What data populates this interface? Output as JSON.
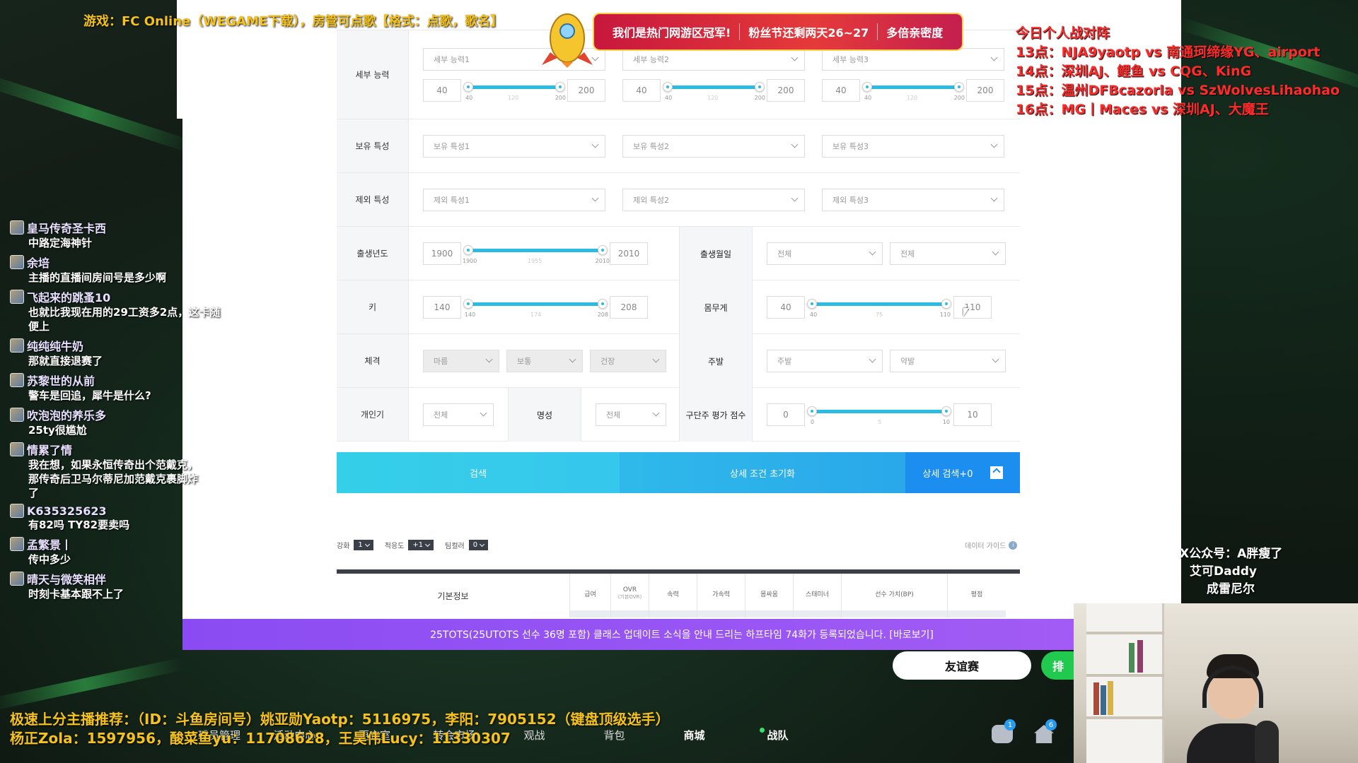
{
  "stream": {
    "top_title": "游戏：FC Online（WEGAME下载），房管可点歌【格式：点歌，歌名】",
    "schedule_title": "今日个人战对阵",
    "schedule": [
      "13点：NJA9yaotp vs 南通珂缔缘YG、airport",
      "14点：深圳AJ、鲤鱼 vs CQG、KinG",
      "15点：温州DFBcazorla vs SzWolvesLihaohao",
      "16点：MG丨Maces vs 深圳AJ、大魔王"
    ],
    "event_banner": [
      "我们是热门网游区冠军!",
      "粉丝节还剩两天26~27",
      "多倍亲密度"
    ],
    "promo": [
      "极速上分主播推荐：（ID：斗鱼房间号）姚亚勋Yaotp：5116975，李阳：7905152（键盘顶级选手）",
      "杨正Zola：1597956，酸菜鱼yu：11708628，王昊伟Lucy：11330307"
    ],
    "right_text": [
      "X公众号：A胖瘦了",
      "艾可Daddy",
      "成雷尼尔"
    ],
    "scroll_arrow": "↓",
    "up_arrow": "↑"
  },
  "chat": [
    {
      "user": "皇马传奇圣卡西",
      "text": "中路定海神针"
    },
    {
      "user": "余培",
      "text": "主播的直播间房间号是多少啊"
    },
    {
      "user": "飞起来的跳蚤10",
      "text": "也就比我现在用的29工资多2点，这卡随便上"
    },
    {
      "user": "纯纯纯牛奶",
      "text": "那就直接退赛了"
    },
    {
      "user": "苏黎世的从前",
      "text": "警车是回追，犀牛是什么?"
    },
    {
      "user": "吹泡泡的养乐多",
      "text": "25ty很尴尬"
    },
    {
      "user": "情累了情",
      "text": "我在想，如果永恒传奇出个范戴克，那传奇后卫马尔蒂尼加范戴克裹脚炸了"
    },
    {
      "user": "K635325623",
      "text": "有82吗 TY82要卖吗"
    },
    {
      "user": "孟繁景丨",
      "text": "传中多少"
    },
    {
      "user": "晴天与微笑相伴",
      "text": "时刻卡基本跟不上了"
    }
  ],
  "form": {
    "detail_ability": {
      "label": "세부 능력",
      "selects": [
        "세부 능력1",
        "세부 능력2",
        "세부 능력3"
      ],
      "min": "40",
      "max": "200",
      "tick_min": "40",
      "tick_mid": "120",
      "tick_max": "200"
    },
    "owned_trait": {
      "label": "보유 특성",
      "selects": [
        "보유 특성1",
        "보유 특성2",
        "보유 특성3"
      ]
    },
    "excluded_trait": {
      "label": "제외 특성",
      "selects": [
        "제외 특성1",
        "제외 특성2",
        "제외 특성3"
      ]
    },
    "birth_year": {
      "label": "출생년도",
      "min": "1900",
      "max": "2010",
      "tick_min": "1900",
      "tick_mid": "1955",
      "tick_max": "2010"
    },
    "birth_month_day": {
      "label": "출생월일",
      "selects": [
        "전체",
        "전체"
      ]
    },
    "height": {
      "label": "키",
      "min": "140",
      "max": "208",
      "tick_min": "140",
      "tick_mid": "174",
      "tick_max": "208"
    },
    "weight": {
      "label": "몸무게",
      "min": "40",
      "max": "110",
      "tick_min": "40",
      "tick_mid": "75",
      "tick_max": "110"
    },
    "body_type": {
      "label": "체격",
      "selects": [
        "마름",
        "보통",
        "건장"
      ]
    },
    "preferred_foot": {
      "label": "주발",
      "selects": [
        "주발",
        "약발"
      ]
    },
    "popularity": {
      "label": "개인기",
      "select": "전체"
    },
    "fame": {
      "label": "명성",
      "select": "전체"
    },
    "rating": {
      "label": "구단주 평가 점수",
      "min": "0",
      "max": "10",
      "tick_min": "0",
      "tick_mid": "5",
      "tick_max": "10"
    }
  },
  "buttons": {
    "search": "검색",
    "reset": "상세 조건 초기화",
    "detail": "상세 검색+0"
  },
  "options": {
    "upgrade_label": "강화",
    "upgrade_value": "1",
    "fit_label": "적응도",
    "fit_value": "+1",
    "teamcolor_label": "팀컬러",
    "teamcolor_value": "0",
    "data_guide": "데이터 가이드"
  },
  "table": {
    "basic": "기본정보",
    "columns": [
      {
        "label": "급여",
        "sub": ""
      },
      {
        "label": "OVR",
        "sub": "(기본OVR)"
      },
      {
        "label": "속력",
        "sub": ""
      },
      {
        "label": "가속력",
        "sub": ""
      },
      {
        "label": "몸싸움",
        "sub": ""
      },
      {
        "label": "스태미너",
        "sub": ""
      },
      {
        "label": "선수 가치(BP)",
        "sub": ""
      },
      {
        "label": "평점",
        "sub": ""
      }
    ]
  },
  "notice_banner": "25TOTS(25UTOTS 선수 36명 포함) 클래스 업데이트 소식을 안내 드리는 하프타임 74화가 등록되었습니다. [바로보기]",
  "game": {
    "friendly": "友谊赛",
    "green_btn": "排",
    "nav": [
      "球员管理",
      "活动中心",
      "更衣室",
      "转会市场",
      "观战",
      "背包",
      "商城",
      "战队"
    ],
    "badge_chat": "1",
    "badge_home": "6",
    "chat_badge": "1"
  }
}
